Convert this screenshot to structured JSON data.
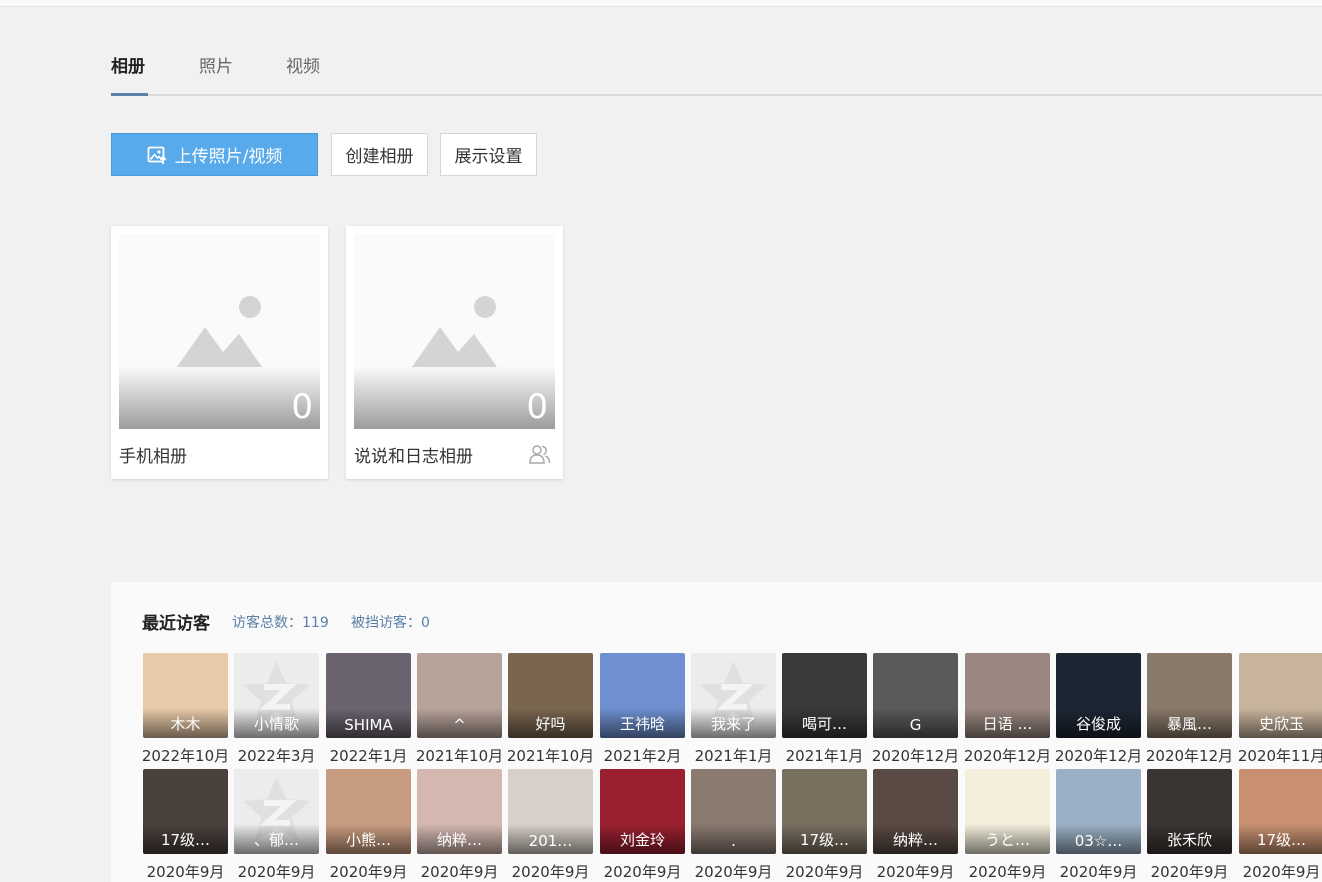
{
  "tabs": [
    {
      "label": "相册",
      "active": true
    },
    {
      "label": "照片",
      "active": false
    },
    {
      "label": "视频",
      "active": false
    }
  ],
  "toolbar": {
    "upload_label": "上传照片/视频",
    "create_label": "创建相册",
    "display_label": "展示设置"
  },
  "albums": [
    {
      "name": "手机相册",
      "count": "0",
      "shared": false
    },
    {
      "name": "说说和日志相册",
      "count": "0",
      "shared": true
    }
  ],
  "visitors_section": {
    "title": "最近访客",
    "total": "访客总数：119",
    "blocked": "被挡访客：0",
    "rows": [
      [
        {
          "name": "木木",
          "date": "2022年10月",
          "color": "#e8c9a8"
        },
        {
          "name": "小情歌",
          "date": "2022年3月",
          "color": "#ececec",
          "default": true
        },
        {
          "name": "SHIMA",
          "date": "2022年1月",
          "color": "#6b6470"
        },
        {
          "name": "^",
          "date": "2021年10月",
          "color": "#b8a39a"
        },
        {
          "name": "好吗",
          "date": "2021年10月",
          "color": "#7a6650"
        },
        {
          "name": "王祎晗",
          "date": "2021年2月",
          "color": "#6e8fd0"
        },
        {
          "name": "我来了",
          "date": "2021年1月",
          "color": "#ececec",
          "default": true
        },
        {
          "name": "喝可…",
          "date": "2021年1月",
          "color": "#3a3a3a"
        },
        {
          "name": "G",
          "date": "2020年12月",
          "color": "#5a5a5a"
        },
        {
          "name": "日语 …",
          "date": "2020年12月",
          "color": "#9a8880"
        },
        {
          "name": "谷俊成",
          "date": "2020年12月",
          "color": "#1d2633"
        },
        {
          "name": "暴風…",
          "date": "2020年12月",
          "color": "#8a7a6a"
        },
        {
          "name": "史欣玉",
          "date": "2020年11月",
          "color": "#c8b49c"
        }
      ],
      [
        {
          "name": "17级…",
          "date": "2020年9月",
          "color": "#4a403c"
        },
        {
          "name": "、郁…",
          "date": "2020年9月",
          "color": "#ececec",
          "default": true
        },
        {
          "name": "小熊…",
          "date": "2020年9月",
          "color": "#c89c80"
        },
        {
          "name": "纳粹…",
          "date": "2020年9月",
          "color": "#d4b8b0"
        },
        {
          "name": "201…",
          "date": "2020年9月",
          "color": "#d8d0c8"
        },
        {
          "name": "刘金玲",
          "date": "2020年9月",
          "color": "#9a2030"
        },
        {
          "name": ".",
          "date": "2020年9月",
          "color": "#8a7a70"
        },
        {
          "name": "17级…",
          "date": "2020年9月",
          "color": "#7a7060"
        },
        {
          "name": "纳粹…",
          "date": "2020年9月",
          "color": "#5a4a44"
        },
        {
          "name": "うと…",
          "date": "2020年9月",
          "color": "#f4efdc"
        },
        {
          "name": "03☆…",
          "date": "2020年9月",
          "color": "#9ab0c4"
        },
        {
          "name": "张禾欣",
          "date": "2020年9月",
          "color": "#3a3432"
        },
        {
          "name": "17级…",
          "date": "2020年9月",
          "color": "#c89070"
        }
      ]
    ]
  }
}
